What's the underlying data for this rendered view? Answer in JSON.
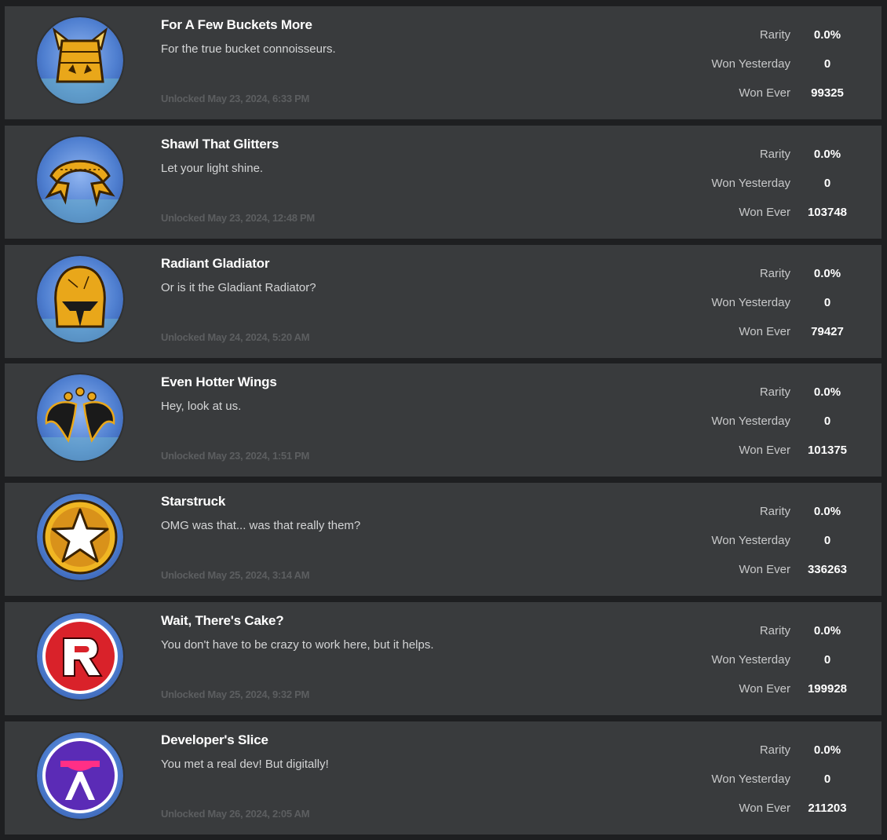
{
  "stats_labels": {
    "rarity": "Rarity",
    "won_yesterday": "Won Yesterday",
    "won_ever": "Won Ever"
  },
  "badges": [
    {
      "name": "For A Few Buckets More",
      "description": "For the true bucket connoisseurs.",
      "unlocked": "Unlocked May 23, 2024, 6:33 PM",
      "rarity": "0.0%",
      "won_yesterday": "0",
      "won_ever": "99325",
      "icon": "golden-horned-bucket-helmet-icon"
    },
    {
      "name": "Shawl That Glitters",
      "description": "Let your light shine.",
      "unlocked": "Unlocked May 23, 2024, 12:48 PM",
      "rarity": "0.0%",
      "won_yesterday": "0",
      "won_ever": "103748",
      "icon": "golden-shawl-icon"
    },
    {
      "name": "Radiant Gladiator",
      "description": "Or is it the Gladiant Radiator?",
      "unlocked": "Unlocked May 24, 2024, 5:20 AM",
      "rarity": "0.0%",
      "won_yesterday": "0",
      "won_ever": "79427",
      "icon": "golden-gladiator-helmet-icon"
    },
    {
      "name": "Even Hotter Wings",
      "description": "Hey, look at us.",
      "unlocked": "Unlocked May 23, 2024, 1:51 PM",
      "rarity": "0.0%",
      "won_yesterday": "0",
      "won_ever": "101375",
      "icon": "golden-wings-icon"
    },
    {
      "name": "Starstruck",
      "description": "OMG was that... was that really them?",
      "unlocked": "Unlocked May 25, 2024, 3:14 AM",
      "rarity": "0.0%",
      "won_yesterday": "0",
      "won_ever": "336263",
      "icon": "star-icon"
    },
    {
      "name": "Wait, There's Cake?",
      "description": "You don't have to be crazy to work here, but it helps.",
      "unlocked": "Unlocked May 25, 2024, 9:32 PM",
      "rarity": "0.0%",
      "won_yesterday": "0",
      "won_ever": "199928",
      "icon": "roblox-r-logo-icon"
    },
    {
      "name": "Developer's Slice",
      "description": "You met a real dev! But digitally!",
      "unlocked": "Unlocked May 26, 2024, 2:05 AM",
      "rarity": "0.0%",
      "won_yesterday": "0",
      "won_ever": "211203",
      "icon": "developer-logo-icon"
    }
  ],
  "colors": {
    "page_background": "#1e1f21",
    "card_background": "#393b3d",
    "gold": "#f3b21b",
    "badge_background_blue": "#5f8fd6"
  }
}
